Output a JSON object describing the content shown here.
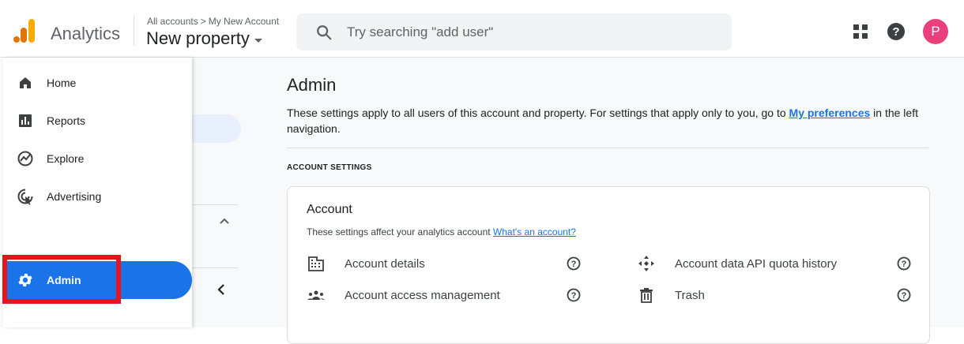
{
  "header": {
    "app_name": "Analytics",
    "breadcrumb": [
      "All accounts",
      ">",
      "My New Account"
    ],
    "property": "New property",
    "search_placeholder": "Try searching \"add user\"",
    "avatar_initial": "P",
    "icons": [
      "apps-grid-icon",
      "help-icon"
    ],
    "colors": {
      "avatar": "#e8407a",
      "logo_orange": "#f9ab00",
      "logo_dark": "#e37400"
    }
  },
  "nav": {
    "items": [
      {
        "label": "Home",
        "icon": "home-icon"
      },
      {
        "label": "Reports",
        "icon": "reports-icon"
      },
      {
        "label": "Explore",
        "icon": "explore-icon"
      },
      {
        "label": "Advertising",
        "icon": "advertising-icon"
      },
      {
        "label": "Admin",
        "icon": "gear-icon",
        "active": true
      }
    ],
    "active_color": "#1a73e8"
  },
  "main": {
    "title": "Admin",
    "description_pre": "These settings apply to all users of this account and property. For settings that apply only to you, go to ",
    "description_link": "My preferences",
    "description_post": " in the left navigation.",
    "section_label": "ACCOUNT SETTINGS",
    "card": {
      "title": "Account",
      "subtitle": "These settings affect your analytics account",
      "subtitle_link": "What's an account?",
      "rows": [
        {
          "label": "Account details",
          "icon": "building-icon"
        },
        {
          "label": "Account data API quota history",
          "icon": "move-arrows-icon"
        },
        {
          "label": "Account access management",
          "icon": "people-icon"
        },
        {
          "label": "Trash",
          "icon": "trash-icon"
        }
      ]
    }
  }
}
